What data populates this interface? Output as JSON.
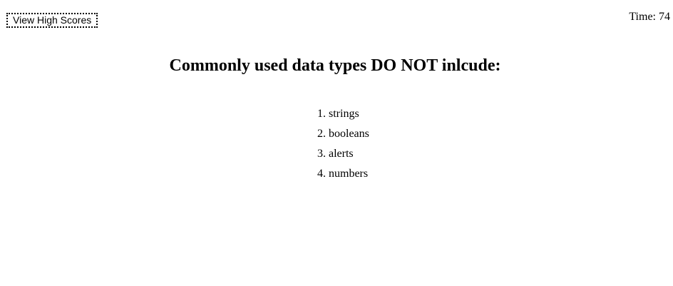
{
  "header": {
    "high_scores_label": "View High Scores",
    "timer_label": "Time:",
    "timer_value": "74"
  },
  "question": {
    "title": "Commonly used data types DO NOT inlcude:",
    "choices": [
      {
        "number": "1.",
        "label": "strings"
      },
      {
        "number": "2.",
        "label": "booleans"
      },
      {
        "number": "3.",
        "label": "alerts"
      },
      {
        "number": "4.",
        "label": "numbers"
      }
    ]
  }
}
